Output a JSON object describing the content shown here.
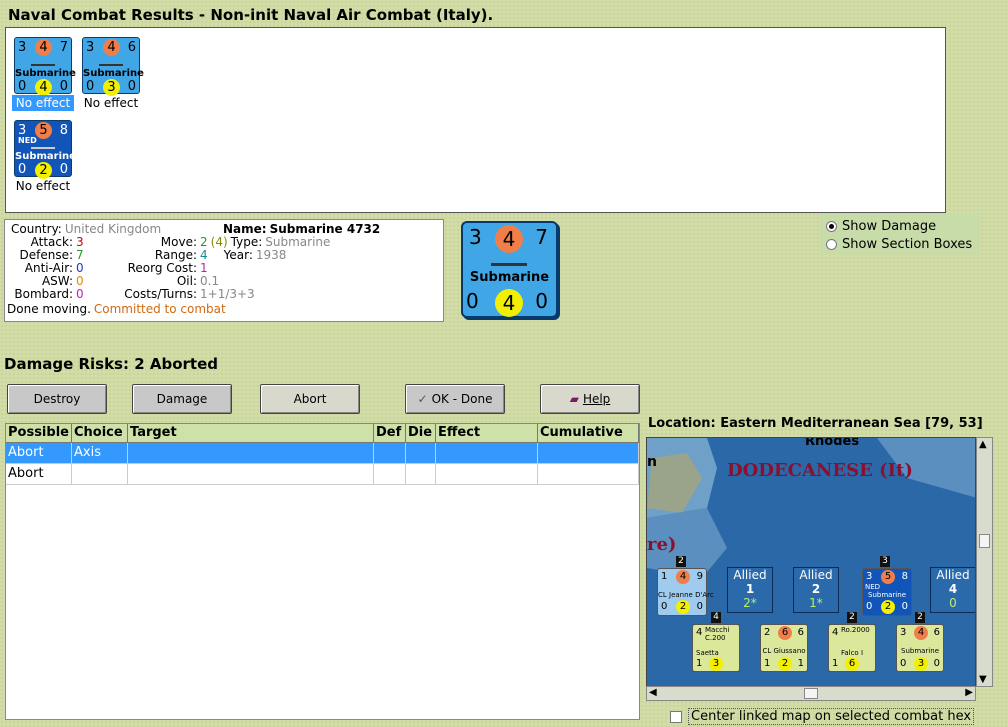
{
  "window_title": "Naval Combat Results - Non-init Naval Air Combat (Italy).",
  "results": [
    {
      "top": "3",
      "mid": "4",
      "right": "7",
      "name": "Submarine",
      "b1": "0",
      "b2": "4",
      "b3": "0",
      "nation": "",
      "effect": "No effect",
      "selected": true
    },
    {
      "top": "3",
      "mid": "4",
      "right": "6",
      "name": "Submarine",
      "b1": "0",
      "b2": "3",
      "b3": "0",
      "nation": "",
      "effect": "No effect",
      "selected": false
    },
    {
      "top": "3",
      "mid": "5",
      "right": "8",
      "name": "Submarine",
      "b1": "0",
      "b2": "2",
      "b3": "0",
      "nation": "NED",
      "effect": "No effect",
      "selected": false
    }
  ],
  "info": {
    "country_label": "Country:",
    "country": "United Kingdom",
    "attack_label": "Attack:",
    "attack": "3",
    "defense_label": "Defense:",
    "defense": "7",
    "aa_label": "Anti-Air:",
    "aa": "0",
    "asw_label": "ASW:",
    "asw": "0",
    "bombard_label": "Bombard:",
    "bombard": "0",
    "name_label": "Name:",
    "name": "Submarine 4732",
    "move_label": "Move:",
    "move": "2",
    "move_paren": "(4)",
    "type_label": "Type:",
    "type": "Submarine",
    "range_label": "Range:",
    "range": "4",
    "year_label": "Year:",
    "year": "1938",
    "reorg_label": "Reorg Cost:",
    "reorg": "1",
    "oil_label": "Oil:",
    "oil": "0.1",
    "costs_label": "Costs/Turns:",
    "costs": "1+1/3+3",
    "status1": "Done moving.",
    "status2": "Committed to combat"
  },
  "big_counter": {
    "top": "3",
    "mid": "4",
    "right": "7",
    "name": "Submarine",
    "b1": "0",
    "b2": "4",
    "b3": "0"
  },
  "radios": [
    {
      "label": "Show Damage",
      "checked": true
    },
    {
      "label": "Show Section Boxes",
      "checked": false
    }
  ],
  "damage_risks": "Damage Risks:  2 Aborted",
  "buttons": {
    "destroy": "Destroy",
    "damage": "Damage",
    "abort": "Abort",
    "ok": "OK - Done",
    "help": "Help"
  },
  "table": {
    "headers": [
      "Possible",
      "Choice",
      "Target",
      "Def",
      "Die",
      "Effect",
      "Cumulative"
    ],
    "rows": [
      [
        "Abort",
        "Axis",
        "",
        "",
        "",
        "",
        ""
      ],
      [
        "Abort",
        "",
        "",
        "",
        "",
        "",
        ""
      ]
    ]
  },
  "location": "Location:  Eastern Mediterranean Sea [79, 53]",
  "map": {
    "rhodes": "Rhodes",
    "dodecanese": "DODECANESE (It)",
    "n": "n",
    "re": "re)",
    "counters_top": [
      {
        "stack": "2",
        "top": "1",
        "mid": "4",
        "right": "9",
        "name": "CL Jeanne D'Arc",
        "b1": "0",
        "b2": "2",
        "b3": "0"
      },
      {
        "stack": "3",
        "top": "3",
        "mid": "5",
        "right": "8",
        "name": "Submarine",
        "nation": "NED",
        "b1": "0",
        "b2": "2",
        "b3": "0"
      }
    ],
    "allied": [
      {
        "label": "Allied",
        "n": "1",
        "s": "2*"
      },
      {
        "label": "Allied",
        "n": "2",
        "s": "1*"
      },
      {
        "label": "Allied",
        "n": "4",
        "s": "0"
      }
    ],
    "counters_bottom": [
      {
        "stack": "4",
        "title": "Macchi C.200",
        "top": "4",
        "name": "Saetta",
        "b1": "1",
        "b2": "3"
      },
      {
        "stack": "",
        "top": "2",
        "mid": "6",
        "right": "6",
        "name": "CL Giussano",
        "b1": "1",
        "b2": "2",
        "b3": "1"
      },
      {
        "stack": "2",
        "title": "Ro.2000",
        "top": "4",
        "name": "Falco I",
        "b1": "1",
        "b2": "6"
      },
      {
        "stack": "2",
        "top": "3",
        "mid": "4",
        "right": "6",
        "name": "Submarine",
        "b1": "0",
        "b2": "3",
        "b3": "0"
      }
    ]
  },
  "center_check": "Center linked map on selected combat hex",
  "colors": {
    "orange": "#f07e4a",
    "yellow": "#f2f000",
    "cyan": "#40a6e6",
    "navy": "#1255b8"
  }
}
